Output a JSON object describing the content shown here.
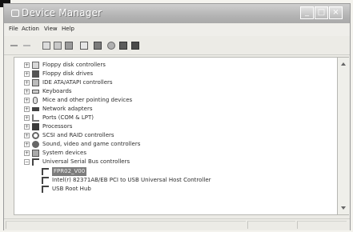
{
  "window": {
    "title": "Device Manager"
  },
  "menubar": {
    "items": [
      "File",
      "Action",
      "View",
      "Help"
    ]
  },
  "toolbar": {
    "icons": [
      "back-arrow-icon",
      "forward-arrow-icon",
      "show-hide-tree-icon",
      "properties-icon",
      "print-icon",
      "help-icon",
      "console-icon",
      "scan-hardware-icon",
      "update-driver-icon",
      "disable-device-icon"
    ]
  },
  "tree": {
    "categories": [
      {
        "label": "Floppy disk controllers",
        "expanded": false,
        "icon": "floppy-controller-icon"
      },
      {
        "label": "Floppy disk drives",
        "expanded": false,
        "icon": "floppy-drive-icon"
      },
      {
        "label": "IDE ATA/ATAPI controllers",
        "expanded": false,
        "icon": "ide-controller-icon"
      },
      {
        "label": "Keyboards",
        "expanded": false,
        "icon": "keyboard-icon"
      },
      {
        "label": "Mice and other pointing devices",
        "expanded": false,
        "icon": "mouse-icon"
      },
      {
        "label": "Network adapters",
        "expanded": false,
        "icon": "network-adapter-icon"
      },
      {
        "label": "Ports (COM & LPT)",
        "expanded": false,
        "icon": "port-icon"
      },
      {
        "label": "Processors",
        "expanded": false,
        "icon": "processor-icon"
      },
      {
        "label": "SCSI and RAID controllers",
        "expanded": false,
        "icon": "scsi-controller-icon"
      },
      {
        "label": "Sound, video and game controllers",
        "expanded": false,
        "icon": "sound-icon"
      },
      {
        "label": "System devices",
        "expanded": false,
        "icon": "system-device-icon"
      },
      {
        "label": "Universal Serial Bus controllers",
        "expanded": true,
        "icon": "usb-icon"
      }
    ],
    "usb_children": [
      {
        "label": "FPR02_V00",
        "selected": true,
        "icon": "usb-device-icon"
      },
      {
        "label": "Intel(r) 82371AB/EB PCI to USB Universal Host Controller",
        "selected": false,
        "icon": "usb-device-icon"
      },
      {
        "label": "USB Root Hub",
        "selected": false,
        "icon": "usb-device-icon"
      }
    ]
  },
  "expand_symbols": {
    "collapsed": "+",
    "expanded": "−"
  },
  "window_buttons": [
    "_",
    "□",
    "×"
  ],
  "colors": {
    "title_gradient_top": "#cfcfcf",
    "title_gradient_bottom": "#a9a9a9",
    "selection": "#7c7c7c",
    "tree_bg": "#ffffff"
  }
}
